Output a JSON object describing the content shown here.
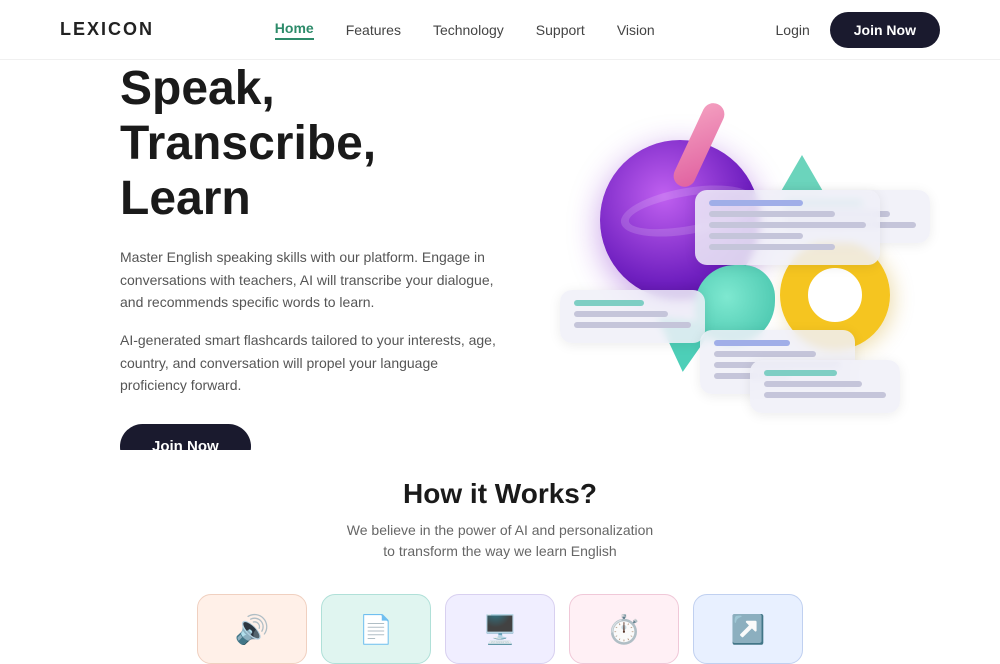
{
  "brand": {
    "name": "LEXICON"
  },
  "navbar": {
    "links": [
      {
        "label": "Home",
        "active": true
      },
      {
        "label": "Features",
        "active": false
      },
      {
        "label": "Technology",
        "active": false
      },
      {
        "label": "Support",
        "active": false
      },
      {
        "label": "Vision",
        "active": false
      }
    ],
    "login_label": "Login",
    "join_label": "Join Now"
  },
  "hero": {
    "title_line1": "Speak,",
    "title_line2": "Transcribe,",
    "title_line3": "Learn",
    "desc1": "Master English speaking skills with our platform. Engage in conversations with teachers, AI will transcribe your dialogue, and recommends specific words to learn.",
    "desc2": "AI-generated smart flashcards tailored to your interests, age, country, and conversation will propel your language proficiency forward.",
    "cta_label": "Join Now"
  },
  "how": {
    "title": "How it Works?",
    "desc_line1": "We believe in the power of AI and personalization",
    "desc_line2": "to transform the way we learn English"
  },
  "bottom_cards": [
    {
      "id": "card-speak",
      "color": "bc-orange",
      "icon": "🔊"
    },
    {
      "id": "card-transcribe",
      "color": "bc-teal",
      "icon": "📄"
    },
    {
      "id": "card-learn",
      "color": "bc-lavender",
      "icon": "🖥️"
    },
    {
      "id": "card-progress",
      "color": "bc-pink",
      "icon": "⏱️"
    },
    {
      "id": "card-share",
      "color": "bc-blue",
      "icon": "↗️"
    }
  ]
}
